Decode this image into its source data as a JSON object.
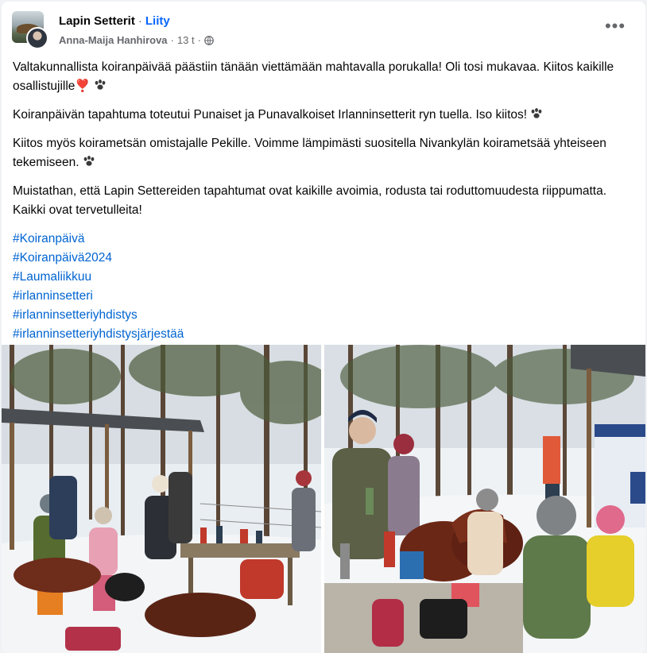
{
  "header": {
    "page_name": "Lapin Setterit",
    "separator": "·",
    "join_label": "Liity",
    "author": "Anna-Maija Hanhirova",
    "time": "13 t",
    "privacy_icon": "globe-icon",
    "more_icon": "more-horizontal-icon",
    "more_label": "•••"
  },
  "post": {
    "paragraphs": [
      {
        "text": "Valtakunnallista koiranpäivää päästiin tänään viettämään mahtavalla porukalla! Oli tosi mukavaa. Kiitos kaikille osallistujille",
        "trail": [
          "heart",
          "paw"
        ]
      },
      {
        "text": "Koiranpäivän tapahtuma toteutui Punaiset ja Punavalkoiset Irlanninsetterit ryn tuella. Iso kiitos!",
        "trail": [
          "paw"
        ]
      },
      {
        "text": "Kiitos myös koirametsän omistajalle Pekille. Voimme lämpimästi suositella Nivankylän koirametsää yhteiseen tekemiseen.",
        "trail": [
          "paw"
        ]
      },
      {
        "text": "Muistathan, että Lapin Settereiden tapahtumat ovat kaikille avoimia, rodusta tai roduttomuudesta riippumatta. Kaikki ovat tervetulleita!",
        "trail": []
      }
    ],
    "heart_emoji": "❣️",
    "hashtags": [
      "#Koiranpäivä",
      "#Koiranpäivä2024",
      "#Laumaliikkuu",
      "#irlanninsetteri",
      "#irlanninsetteriyhdistys",
      "#irlanninsetteriyhdistysjärjestää"
    ]
  },
  "photos": [
    {
      "name": "photo-shelter-table"
    },
    {
      "name": "photo-setters-children"
    }
  ],
  "colors": {
    "link": "#0866ff",
    "hashtag": "#0064d1",
    "text": "#050505",
    "meta": "#65676b"
  }
}
